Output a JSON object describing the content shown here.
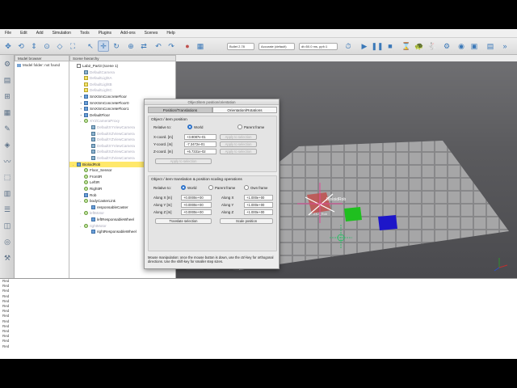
{
  "menubar": [
    "File",
    "Edit",
    "Add",
    "Simulation",
    "Tools",
    "Plugins",
    "Add-ons",
    "Scenes",
    "Help"
  ],
  "toolbar": {
    "engine": "Bullet 2.78",
    "accuracy": "Accurate (default)",
    "timestep": "dt=50.0 ms, ppf=1"
  },
  "panels": {
    "model_browser_title": "Model browser",
    "model_folder": "Model folder: not found",
    "hierarchy_title": "Scene hierarchy"
  },
  "hierarchy": [
    {
      "label": "Lab2_Part3 (scene 1)",
      "kind": "scene",
      "indent": 0,
      "dim": false,
      "exp": "",
      "selected": false
    },
    {
      "label": "DefaultCamera",
      "kind": "cam",
      "indent": 1,
      "dim": true,
      "exp": "",
      "selected": false
    },
    {
      "label": "DefaultLightA",
      "kind": "light",
      "indent": 1,
      "dim": true,
      "exp": "",
      "selected": false
    },
    {
      "label": "DefaultLightB",
      "kind": "light",
      "indent": 1,
      "dim": true,
      "exp": "",
      "selected": false
    },
    {
      "label": "DefaultLightC",
      "kind": "light",
      "indent": 1,
      "dim": true,
      "exp": "",
      "selected": false
    },
    {
      "label": "SmXSmConcreteFloor",
      "kind": "shape",
      "indent": 1,
      "dim": false,
      "exp": "+",
      "selected": false
    },
    {
      "label": "SmXSmConcreteFloor0",
      "kind": "shape",
      "indent": 1,
      "dim": false,
      "exp": "+",
      "selected": false
    },
    {
      "label": "SmXSmConcreteFloor1",
      "kind": "shape",
      "indent": 1,
      "dim": false,
      "exp": "+",
      "selected": false
    },
    {
      "label": "DefaultFloor",
      "kind": "shape",
      "indent": 1,
      "dim": false,
      "exp": "+",
      "selected": false
    },
    {
      "label": "XYZCameraProxy",
      "kind": "dummy",
      "indent": 1,
      "dim": true,
      "exp": "-",
      "selected": false
    },
    {
      "label": "DefaultXYViewCamera",
      "kind": "cam",
      "indent": 2,
      "dim": true,
      "exp": "",
      "selected": false
    },
    {
      "label": "DefaultXZViewCamera",
      "kind": "cam",
      "indent": 2,
      "dim": true,
      "exp": "",
      "selected": false
    },
    {
      "label": "DefaultYZViewCamera",
      "kind": "cam",
      "indent": 2,
      "dim": true,
      "exp": "",
      "selected": false
    },
    {
      "label": "DefaultXYViewCamera",
      "kind": "cam",
      "indent": 2,
      "dim": true,
      "exp": "",
      "selected": false
    },
    {
      "label": "DefaultXZViewCamera",
      "kind": "cam",
      "indent": 2,
      "dim": true,
      "exp": "",
      "selected": false
    },
    {
      "label": "DefaultYZViewCamera",
      "kind": "cam",
      "indent": 2,
      "dim": true,
      "exp": "",
      "selected": false
    },
    {
      "label": "BioloidRob",
      "kind": "shape",
      "indent": 0,
      "dim": false,
      "exp": "-",
      "selected": true
    },
    {
      "label": "Floor_Sensor",
      "kind": "dummy",
      "indent": 1,
      "dim": false,
      "exp": "",
      "selected": false
    },
    {
      "label": "FrontIR",
      "kind": "dummy",
      "indent": 1,
      "dim": false,
      "exp": "",
      "selected": false
    },
    {
      "label": "LeftIR",
      "kind": "dummy",
      "indent": 1,
      "dim": false,
      "exp": "",
      "selected": false
    },
    {
      "label": "RightIR",
      "kind": "dummy",
      "indent": 1,
      "dim": false,
      "exp": "",
      "selected": false
    },
    {
      "label": "Rob",
      "kind": "shape",
      "indent": 1,
      "dim": false,
      "exp": "",
      "selected": false
    },
    {
      "label": "bodyCasterLink",
      "kind": "dummy",
      "indent": 1,
      "dim": false,
      "exp": "-",
      "selected": false
    },
    {
      "label": "responsableCaster",
      "kind": "shape",
      "indent": 2,
      "dim": false,
      "exp": "",
      "selected": false
    },
    {
      "label": "leftMotor",
      "kind": "dummy",
      "indent": 1,
      "dim": true,
      "exp": "-",
      "selected": false
    },
    {
      "label": "leftResponsableWheel",
      "kind": "shape",
      "indent": 2,
      "dim": false,
      "exp": "",
      "selected": false
    },
    {
      "label": "rightMotor",
      "kind": "dummy",
      "indent": 1,
      "dim": true,
      "exp": "-",
      "selected": false
    },
    {
      "label": "rightResponsableWheel",
      "kind": "shape",
      "indent": 2,
      "dim": false,
      "exp": "",
      "selected": false
    }
  ],
  "dialog": {
    "title": "Object/item position/orientation",
    "tab_position": "Position/Translations",
    "tab_orientation": "Orientation/Rotations",
    "pos_group_title": "Object / item position",
    "relative_to": "Relative to:",
    "world": "World",
    "parent_frame": "Parent frame",
    "x_label": "X-coord. [m]",
    "x_value": "+3.9087e-01",
    "y_label": "Y-coord. [m]",
    "y_value": "-7.3472e-01",
    "z_label": "Z-coord. [m]",
    "z_value": "+6.7331e-02",
    "apply_to_selection": "Apply to selection",
    "trans_group_title": "Object / item translation & position scaling operations",
    "relative_to_2": "Relative to:",
    "world_2": "World",
    "parent_frame_2": "Parent frame",
    "own_frame": "Own frame",
    "along_x": "Along X [m]",
    "along_y": "Along Y [m]",
    "along_z": "Along Z [m]",
    "along_x_value": "+0.0000e+00",
    "along_y_value": "+0.0000e+00",
    "along_z_value": "+0.0000e+00",
    "scale_x": "Along X",
    "scale_y": "Along Y",
    "scale_z": "Along Z",
    "scale_x_value": "+1.000e+00",
    "scale_y_value": "+1.000e+00",
    "scale_z_value": "+1.000e+00",
    "translate_selection": "Translate selection",
    "scale_position": "Scale position",
    "note": "Mouse manipulation: once the mouse button is down, use the ctrl-key for orthogonal directions. Use the shift-key for smaller step sizes."
  },
  "scene": {
    "watermark": "EDU",
    "robot_label": "BioloidRob",
    "robot_sublabel": "ZXZ_Rob",
    "green_color": "#1fbf1f",
    "blue_color": "#1d16c9"
  },
  "status_lines": [
    "Red",
    "Red",
    "Red",
    "Red",
    "Red",
    "Red",
    "Red",
    "Red",
    "Red",
    "Red",
    "Red",
    "Red",
    "Red",
    "Red"
  ]
}
